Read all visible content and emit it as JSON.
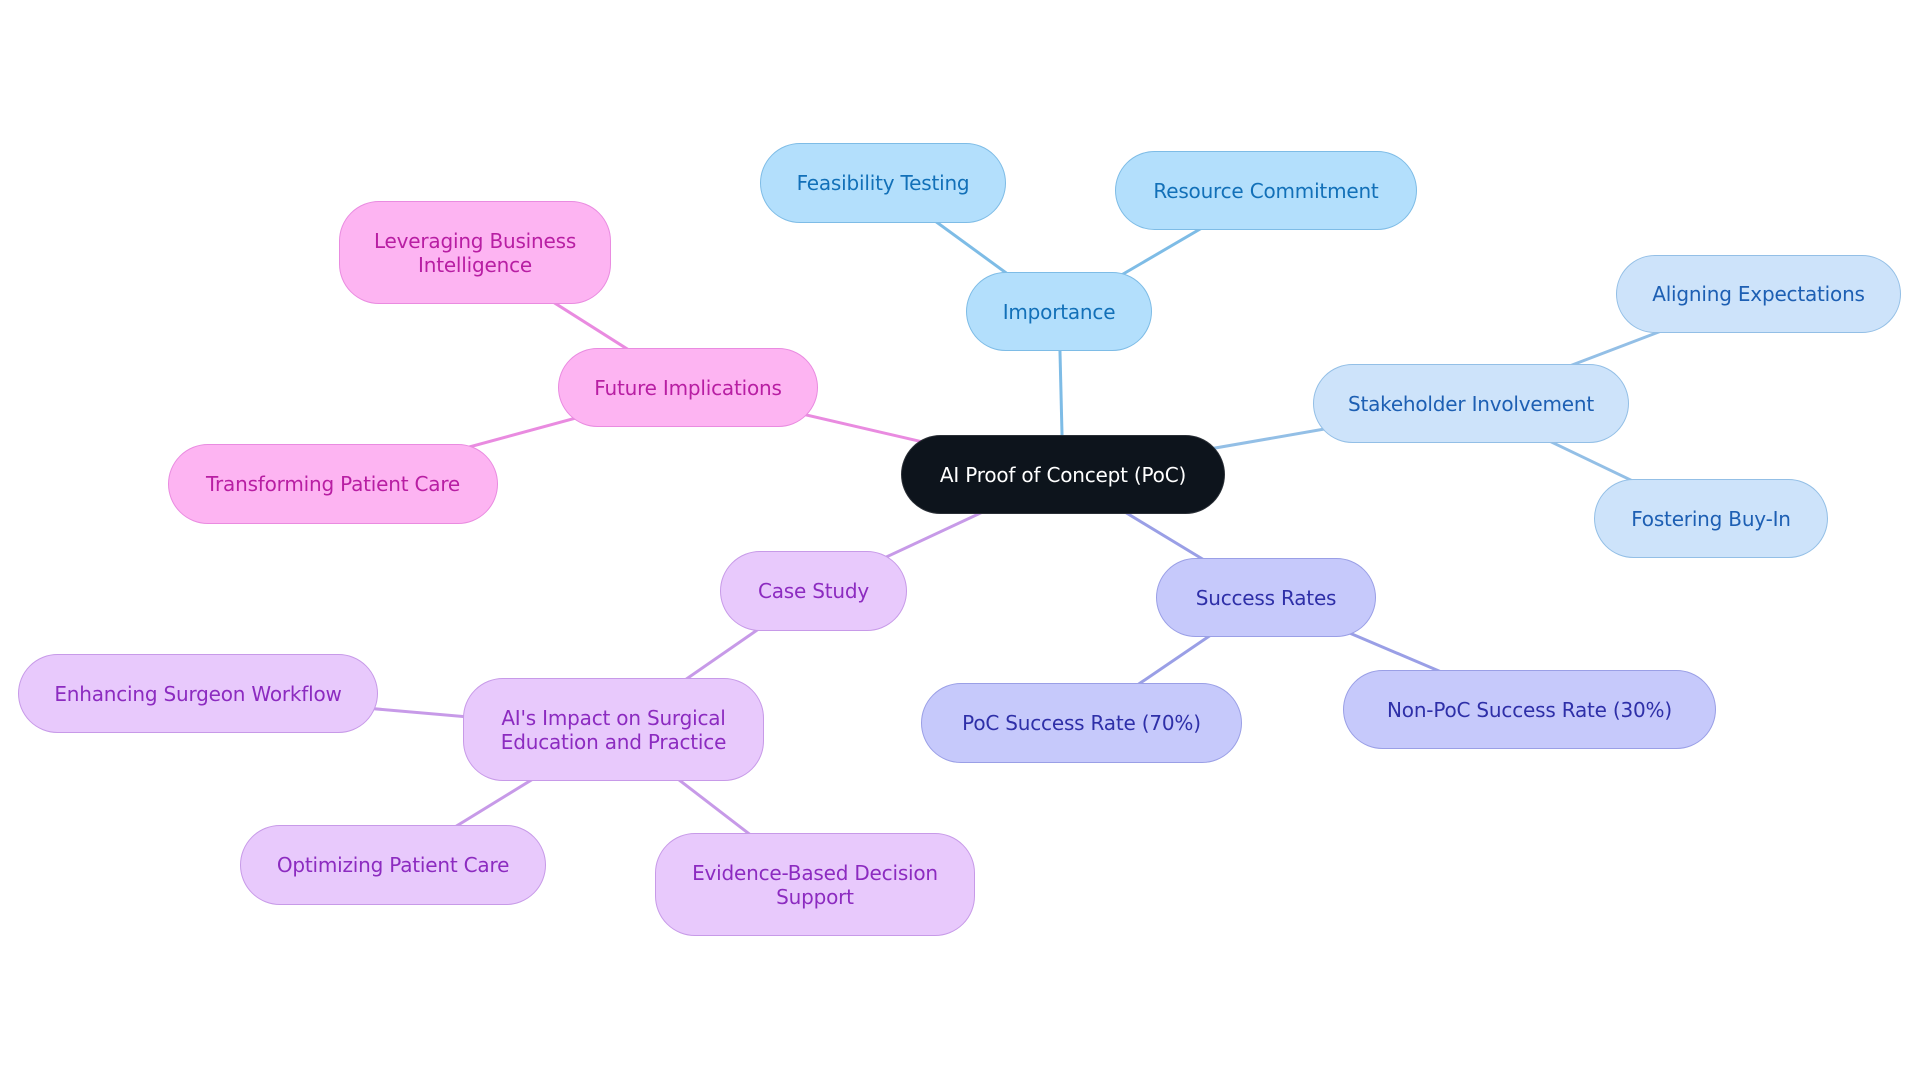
{
  "diagram": {
    "type": "mind-map",
    "root": {
      "id": "root",
      "label": "AI Proof of Concept (PoC)"
    },
    "branches": [
      {
        "id": "importance",
        "label": "Importance",
        "color": "#7ebce6",
        "children": [
          {
            "id": "feasibility",
            "label": "Feasibility Testing"
          },
          {
            "id": "resource",
            "label": "Resource Commitment"
          }
        ]
      },
      {
        "id": "stakeholder",
        "label": "Stakeholder Involvement",
        "color": "#93bfe6",
        "children": [
          {
            "id": "aligning",
            "label": "Aligning Expectations"
          },
          {
            "id": "fostering",
            "label": "Fostering Buy-In"
          }
        ]
      },
      {
        "id": "success",
        "label": "Success Rates",
        "color": "#9a9fe6",
        "children": [
          {
            "id": "poc-rate",
            "label": "PoC Success Rate (70%)"
          },
          {
            "id": "nonpoc-rate",
            "label": "Non-PoC Success Rate (30%)"
          }
        ]
      },
      {
        "id": "future",
        "label": "Future Implications",
        "color": "#e98be0",
        "children": [
          {
            "id": "leveraging",
            "label": "Leveraging Business Intelligence"
          },
          {
            "id": "transforming",
            "label": "Transforming Patient Care"
          }
        ]
      },
      {
        "id": "casestudy",
        "label": "Case Study",
        "color": "#c79ae8",
        "children": [
          {
            "id": "aiimpact",
            "label": "AI's Impact on Surgical Education and Practice",
            "children": [
              {
                "id": "enhancing",
                "label": "Enhancing Surgeon Workflow"
              },
              {
                "id": "optimizing",
                "label": "Optimizing Patient Care"
              },
              {
                "id": "evidence",
                "label": "Evidence-Based Decision Support"
              }
            ]
          }
        ]
      }
    ]
  },
  "labels": {
    "root": "AI Proof of Concept (PoC)",
    "importance": "Importance",
    "feasibility": "Feasibility Testing",
    "resource": "Resource Commitment",
    "stakeholder": "Stakeholder Involvement",
    "aligning": "Aligning Expectations",
    "fostering": "Fostering Buy-In",
    "success": "Success Rates",
    "poc_rate": "PoC Success Rate (70%)",
    "nonpoc_rate": "Non-PoC Success Rate (30%)",
    "future": "Future Implications",
    "leveraging_1": "Leveraging Business",
    "leveraging_2": "Intelligence",
    "transforming": "Transforming Patient Care",
    "casestudy": "Case Study",
    "aiimpact_1": "AI's Impact on Surgical",
    "aiimpact_2": "Education and Practice",
    "enhancing": "Enhancing Surgeon Workflow",
    "optimizing": "Optimizing Patient Care",
    "evidence_1": "Evidence-Based Decision",
    "evidence_2": "Support"
  },
  "edges": [
    {
      "from": "root",
      "to": "importance",
      "color": "#7ebce6"
    },
    {
      "from": "importance",
      "to": "feasibility",
      "color": "#7ebce6"
    },
    {
      "from": "importance",
      "to": "resource",
      "color": "#7ebce6"
    },
    {
      "from": "root",
      "to": "stakeholder",
      "color": "#93bfe6"
    },
    {
      "from": "stakeholder",
      "to": "aligning",
      "color": "#93bfe6"
    },
    {
      "from": "stakeholder",
      "to": "fostering",
      "color": "#93bfe6"
    },
    {
      "from": "root",
      "to": "success",
      "color": "#9a9fe6"
    },
    {
      "from": "success",
      "to": "poc-rate",
      "color": "#9a9fe6"
    },
    {
      "from": "success",
      "to": "nonpoc-rate",
      "color": "#9a9fe6"
    },
    {
      "from": "root",
      "to": "future",
      "color": "#e98be0"
    },
    {
      "from": "future",
      "to": "leveraging",
      "color": "#e98be0"
    },
    {
      "from": "future",
      "to": "transforming",
      "color": "#e98be0"
    },
    {
      "from": "root",
      "to": "casestudy",
      "color": "#c79ae8"
    },
    {
      "from": "casestudy",
      "to": "aiimpact",
      "color": "#c79ae8"
    },
    {
      "from": "aiimpact",
      "to": "enhancing",
      "color": "#c79ae8"
    },
    {
      "from": "aiimpact",
      "to": "optimizing",
      "color": "#c79ae8"
    },
    {
      "from": "aiimpact",
      "to": "evidence",
      "color": "#c79ae8"
    }
  ]
}
